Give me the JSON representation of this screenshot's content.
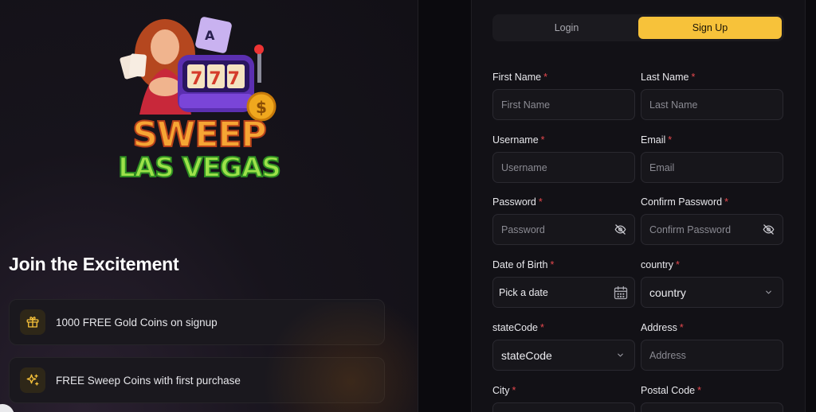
{
  "left": {
    "logo": {
      "line1": "SWEEP",
      "line2": "LAS VEGAS",
      "machine": "777"
    },
    "join_title": "Join the Excitement",
    "perks": [
      {
        "icon": "gift-icon",
        "text": "1000 FREE Gold Coins on signup"
      },
      {
        "icon": "sparkles-icon",
        "text": "FREE Sweep Coins with first purchase"
      }
    ]
  },
  "tabs": {
    "login": "Login",
    "signup": "Sign Up",
    "active": "signup"
  },
  "form": {
    "first_name": {
      "label": "First Name",
      "placeholder": "First Name"
    },
    "last_name": {
      "label": "Last Name",
      "placeholder": "Last Name"
    },
    "username": {
      "label": "Username",
      "placeholder": "Username"
    },
    "email": {
      "label": "Email",
      "placeholder": "Email"
    },
    "password": {
      "label": "Password",
      "placeholder": "Password"
    },
    "confirm_password": {
      "label": "Confirm Password",
      "placeholder": "Confirm Password"
    },
    "dob": {
      "label": "Date of Birth",
      "placeholder": "Pick a date"
    },
    "country": {
      "label": "country",
      "value": "country"
    },
    "state": {
      "label": "stateCode",
      "value": "stateCode"
    },
    "address": {
      "label": "Address",
      "placeholder": "Address"
    },
    "city": {
      "label": "City"
    },
    "postal_code": {
      "label": "Postal Code"
    },
    "required_mark": "*"
  },
  "colors": {
    "accent": "#f7c23a",
    "required": "#e5484d",
    "background": "#121116"
  }
}
